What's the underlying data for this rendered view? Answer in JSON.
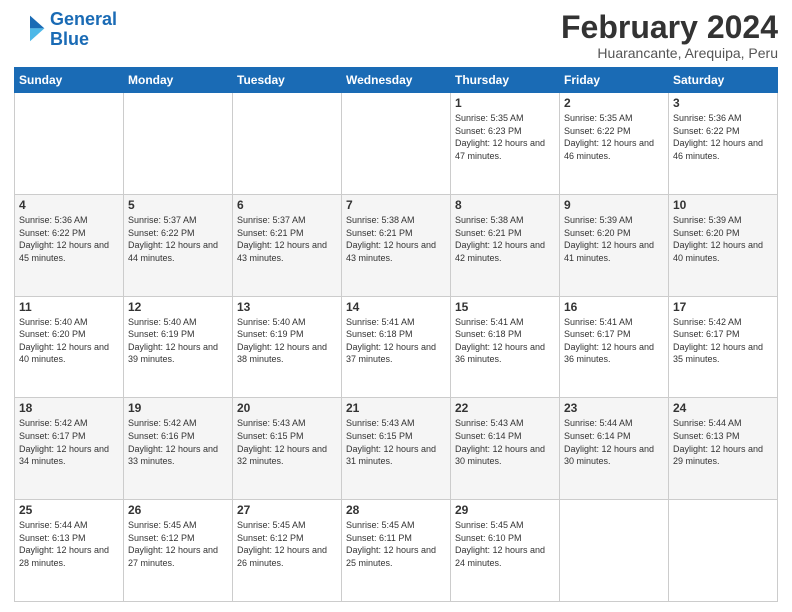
{
  "logo": {
    "line1": "General",
    "line2": "Blue"
  },
  "title": "February 2024",
  "location": "Huarancante, Arequipa, Peru",
  "days_of_week": [
    "Sunday",
    "Monday",
    "Tuesday",
    "Wednesday",
    "Thursday",
    "Friday",
    "Saturday"
  ],
  "weeks": [
    [
      {
        "num": "",
        "info": ""
      },
      {
        "num": "",
        "info": ""
      },
      {
        "num": "",
        "info": ""
      },
      {
        "num": "",
        "info": ""
      },
      {
        "num": "1",
        "info": "Sunrise: 5:35 AM\nSunset: 6:23 PM\nDaylight: 12 hours\nand 47 minutes."
      },
      {
        "num": "2",
        "info": "Sunrise: 5:35 AM\nSunset: 6:22 PM\nDaylight: 12 hours\nand 46 minutes."
      },
      {
        "num": "3",
        "info": "Sunrise: 5:36 AM\nSunset: 6:22 PM\nDaylight: 12 hours\nand 46 minutes."
      }
    ],
    [
      {
        "num": "4",
        "info": "Sunrise: 5:36 AM\nSunset: 6:22 PM\nDaylight: 12 hours\nand 45 minutes."
      },
      {
        "num": "5",
        "info": "Sunrise: 5:37 AM\nSunset: 6:22 PM\nDaylight: 12 hours\nand 44 minutes."
      },
      {
        "num": "6",
        "info": "Sunrise: 5:37 AM\nSunset: 6:21 PM\nDaylight: 12 hours\nand 43 minutes."
      },
      {
        "num": "7",
        "info": "Sunrise: 5:38 AM\nSunset: 6:21 PM\nDaylight: 12 hours\nand 43 minutes."
      },
      {
        "num": "8",
        "info": "Sunrise: 5:38 AM\nSunset: 6:21 PM\nDaylight: 12 hours\nand 42 minutes."
      },
      {
        "num": "9",
        "info": "Sunrise: 5:39 AM\nSunset: 6:20 PM\nDaylight: 12 hours\nand 41 minutes."
      },
      {
        "num": "10",
        "info": "Sunrise: 5:39 AM\nSunset: 6:20 PM\nDaylight: 12 hours\nand 40 minutes."
      }
    ],
    [
      {
        "num": "11",
        "info": "Sunrise: 5:40 AM\nSunset: 6:20 PM\nDaylight: 12 hours\nand 40 minutes."
      },
      {
        "num": "12",
        "info": "Sunrise: 5:40 AM\nSunset: 6:19 PM\nDaylight: 12 hours\nand 39 minutes."
      },
      {
        "num": "13",
        "info": "Sunrise: 5:40 AM\nSunset: 6:19 PM\nDaylight: 12 hours\nand 38 minutes."
      },
      {
        "num": "14",
        "info": "Sunrise: 5:41 AM\nSunset: 6:18 PM\nDaylight: 12 hours\nand 37 minutes."
      },
      {
        "num": "15",
        "info": "Sunrise: 5:41 AM\nSunset: 6:18 PM\nDaylight: 12 hours\nand 36 minutes."
      },
      {
        "num": "16",
        "info": "Sunrise: 5:41 AM\nSunset: 6:17 PM\nDaylight: 12 hours\nand 36 minutes."
      },
      {
        "num": "17",
        "info": "Sunrise: 5:42 AM\nSunset: 6:17 PM\nDaylight: 12 hours\nand 35 minutes."
      }
    ],
    [
      {
        "num": "18",
        "info": "Sunrise: 5:42 AM\nSunset: 6:17 PM\nDaylight: 12 hours\nand 34 minutes."
      },
      {
        "num": "19",
        "info": "Sunrise: 5:42 AM\nSunset: 6:16 PM\nDaylight: 12 hours\nand 33 minutes."
      },
      {
        "num": "20",
        "info": "Sunrise: 5:43 AM\nSunset: 6:15 PM\nDaylight: 12 hours\nand 32 minutes."
      },
      {
        "num": "21",
        "info": "Sunrise: 5:43 AM\nSunset: 6:15 PM\nDaylight: 12 hours\nand 31 minutes."
      },
      {
        "num": "22",
        "info": "Sunrise: 5:43 AM\nSunset: 6:14 PM\nDaylight: 12 hours\nand 30 minutes."
      },
      {
        "num": "23",
        "info": "Sunrise: 5:44 AM\nSunset: 6:14 PM\nDaylight: 12 hours\nand 30 minutes."
      },
      {
        "num": "24",
        "info": "Sunrise: 5:44 AM\nSunset: 6:13 PM\nDaylight: 12 hours\nand 29 minutes."
      }
    ],
    [
      {
        "num": "25",
        "info": "Sunrise: 5:44 AM\nSunset: 6:13 PM\nDaylight: 12 hours\nand 28 minutes."
      },
      {
        "num": "26",
        "info": "Sunrise: 5:45 AM\nSunset: 6:12 PM\nDaylight: 12 hours\nand 27 minutes."
      },
      {
        "num": "27",
        "info": "Sunrise: 5:45 AM\nSunset: 6:12 PM\nDaylight: 12 hours\nand 26 minutes."
      },
      {
        "num": "28",
        "info": "Sunrise: 5:45 AM\nSunset: 6:11 PM\nDaylight: 12 hours\nand 25 minutes."
      },
      {
        "num": "29",
        "info": "Sunrise: 5:45 AM\nSunset: 6:10 PM\nDaylight: 12 hours\nand 24 minutes."
      },
      {
        "num": "",
        "info": ""
      },
      {
        "num": "",
        "info": ""
      }
    ]
  ]
}
